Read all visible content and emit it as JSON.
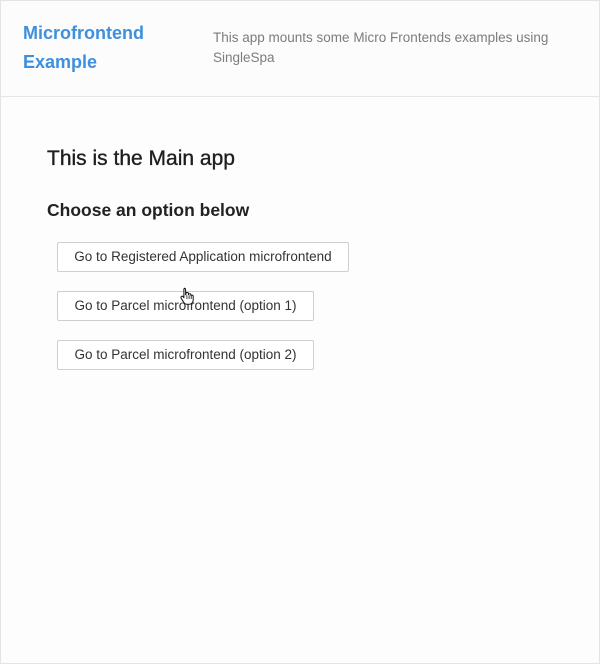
{
  "header": {
    "brand": "Microfrontend Example",
    "tagline": "This app mounts some Micro Frontends examples using SingleSpa"
  },
  "main": {
    "title": "This is the Main app",
    "subtitle": "Choose an option below",
    "buttons": [
      {
        "label": "Go to Registered Application microfrontend"
      },
      {
        "label": "Go to Parcel microfrontend (option 1)"
      },
      {
        "label": "Go to Parcel microfrontend (option 2)"
      }
    ]
  },
  "icons": {
    "cursor": "hand-pointer-icon"
  },
  "colors": {
    "brand": "#3d8fdf",
    "tagline": "#7c7c7c",
    "button_border": "#cfcfcf",
    "heading": "#1e1e1e"
  }
}
